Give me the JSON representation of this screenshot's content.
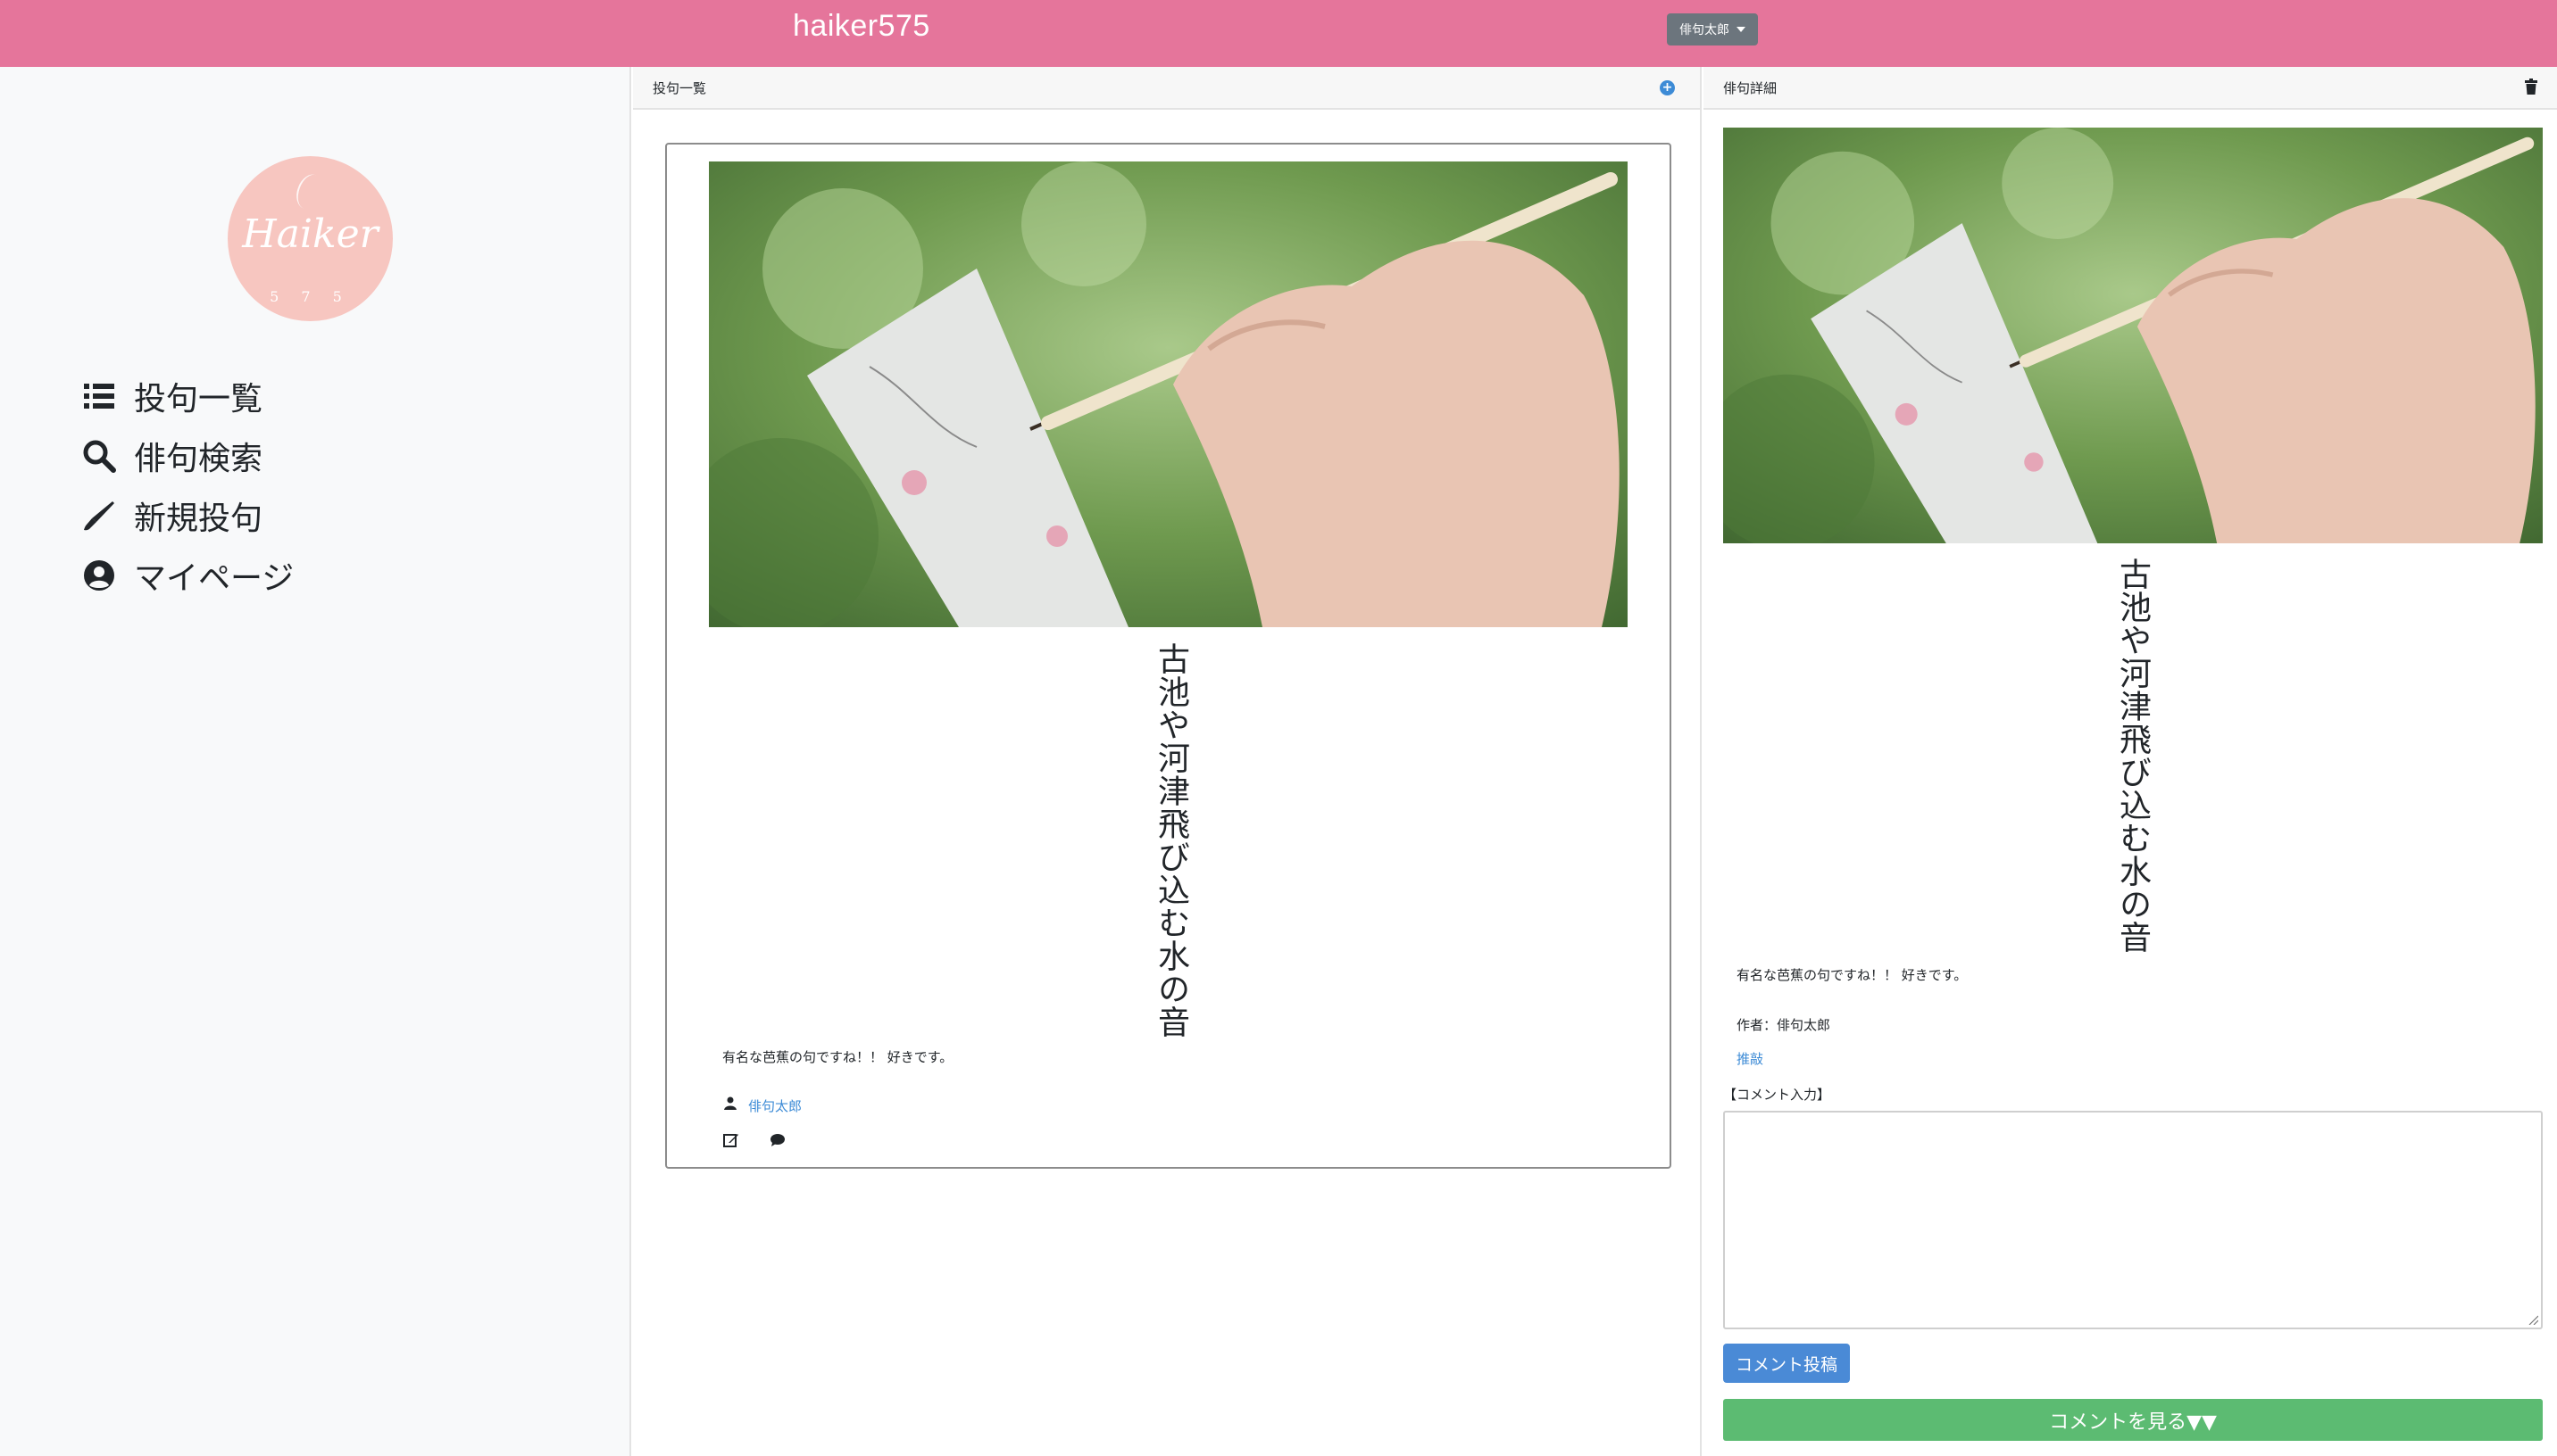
{
  "app": {
    "brand": "haiker575",
    "user_menu_label": "俳句太郎"
  },
  "logo": {
    "text": "Haiker",
    "sub": "5 7 5"
  },
  "sidebar": {
    "items": [
      {
        "label": "投句一覧",
        "icon": "list-icon"
      },
      {
        "label": "俳句検索",
        "icon": "search-icon"
      },
      {
        "label": "新規投句",
        "icon": "pen-icon"
      },
      {
        "label": "マイページ",
        "icon": "user-circle-icon"
      }
    ]
  },
  "list_panel": {
    "title": "投句一覧",
    "post": {
      "haiku": "古池や河津飛び込む水の音",
      "comment": "有名な芭蕉の句ですね！！ 好きです。",
      "author": "俳句太郎"
    }
  },
  "detail_panel": {
    "title": "俳句詳細",
    "haiku": "古池や河津飛び込む水の音",
    "comment": "有名な芭蕉の句ですね！！ 好きです。",
    "author_line": "作者：俳句太郎",
    "recommend_link": "推敲",
    "comment_input_label": "【コメント入力】",
    "comment_value": "",
    "post_button": "コメント投稿",
    "view_comments_button": "コメントを見る▼▼"
  },
  "colors": {
    "navbar": "#e5759b",
    "primary": "#4a8ad6",
    "success": "#5cbb72",
    "logo": "#f7c6c0"
  }
}
